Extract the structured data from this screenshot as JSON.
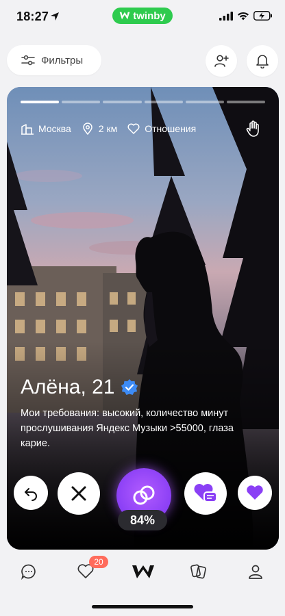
{
  "status_bar": {
    "time": "18:27",
    "brand": "twinby",
    "battery_icon": "battery-charging-icon",
    "wifi_icon": "wifi-icon",
    "signal_icon": "cellular-signal-icon"
  },
  "top_bar": {
    "filter_label": "Фильтры",
    "filter_icon": "sliders-icon",
    "add_friend_icon": "add-person-icon",
    "notifications_icon": "bell-icon"
  },
  "profile": {
    "photo_progress": {
      "total": 6,
      "active_index": 0
    },
    "tags": [
      {
        "icon": "city-icon",
        "label": "Москва"
      },
      {
        "icon": "location-pin-icon",
        "label": "2 км"
      },
      {
        "icon": "hearts-icon",
        "label": "Отношения"
      }
    ],
    "name_age": "Алёна, 21",
    "verified": true,
    "bio": "Мои требования: высокий, количество минут прослушивания Яндекс Музыки >55000, глаза карие.",
    "compatibility": "84%"
  },
  "actions": {
    "undo_icon": "undo-icon",
    "dislike_icon": "close-icon",
    "match_icon": "rings-icon",
    "message_like_icon": "heart-message-icon",
    "like_icon": "heart-icon"
  },
  "bottom_nav": {
    "items": [
      "chat-icon",
      "likes-icon",
      "twinby-logo-icon",
      "cards-icon",
      "profile-icon"
    ],
    "likes_badge": "20"
  },
  "colors": {
    "brand_green": "#2ecb4e",
    "accent_purple": "#8a3ff5",
    "badge_red": "#ff6b5b",
    "verified_blue": "#3d8bf5"
  }
}
